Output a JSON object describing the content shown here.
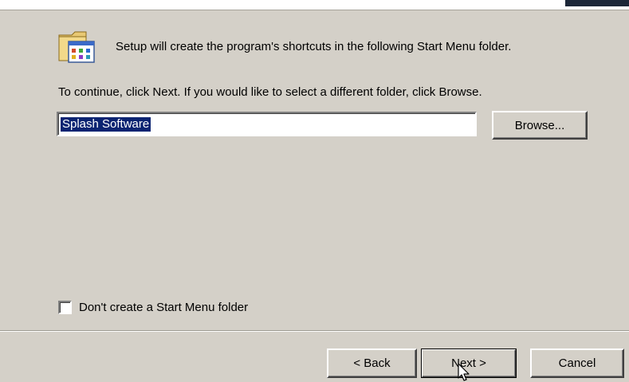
{
  "wizard": {
    "intro_text": "Setup will create the program's shortcuts in the following Start Menu folder.",
    "instruction_text": "To continue, click Next. If you would like to select a different folder, click Browse.",
    "folder_name": "Splash Software",
    "browse_label": "Browse...",
    "no_folder_checkbox": {
      "label": "Don't create a Start Menu folder",
      "checked": false
    },
    "folder_icon": "start-menu-folder-icon"
  },
  "footer": {
    "back_label": "< Back",
    "next_label": "Next >",
    "cancel_label": "Cancel"
  },
  "colors": {
    "dialog_bg": "#d4d0c8",
    "selection_bg": "#0b2472",
    "selection_text": "#ffffff"
  },
  "cursor_icon": "arrow-pointer-icon"
}
